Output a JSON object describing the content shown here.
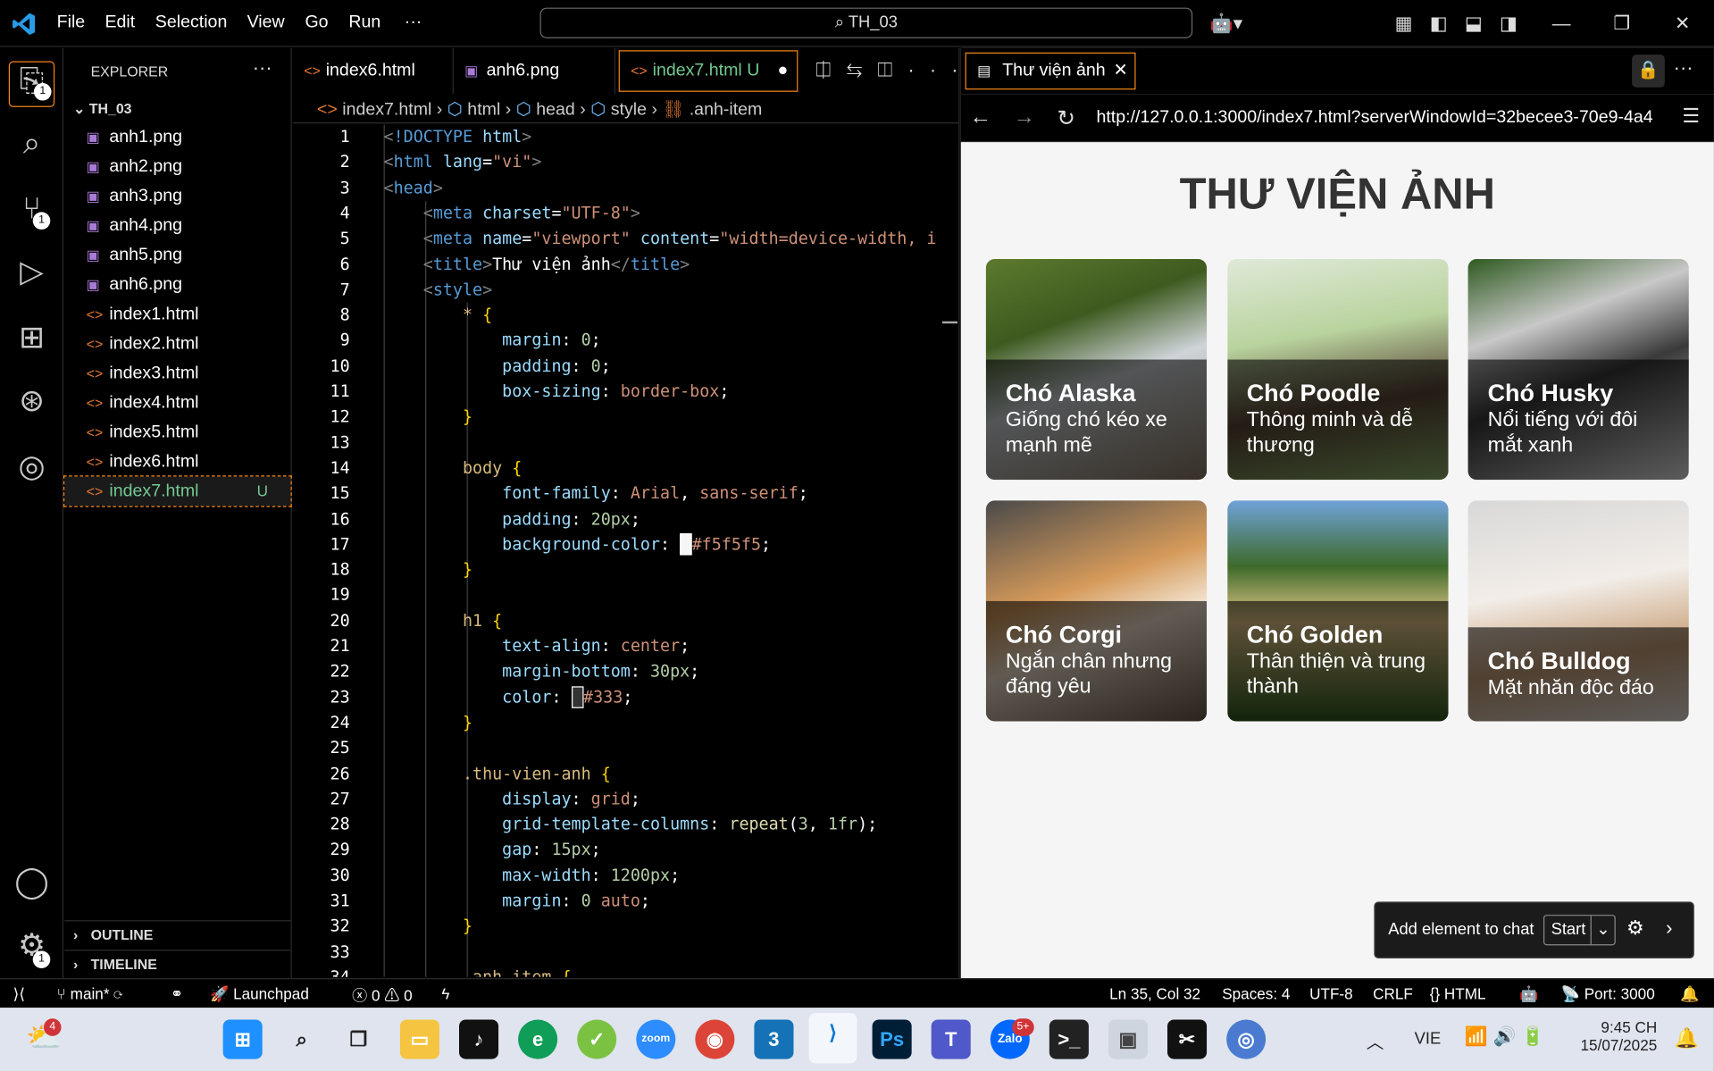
{
  "menu": [
    "File",
    "Edit",
    "Selection",
    "View",
    "Go",
    "Run",
    "···"
  ],
  "command_center": "TH_03",
  "explorer": {
    "header": "EXPLORER",
    "root": "TH_03",
    "files": [
      {
        "name": "anh1.png",
        "type": "img"
      },
      {
        "name": "anh2.png",
        "type": "img"
      },
      {
        "name": "anh3.png",
        "type": "img"
      },
      {
        "name": "anh4.png",
        "type": "img"
      },
      {
        "name": "anh5.png",
        "type": "img"
      },
      {
        "name": "anh6.png",
        "type": "img"
      },
      {
        "name": "index1.html",
        "type": "html"
      },
      {
        "name": "index2.html",
        "type": "html"
      },
      {
        "name": "index3.html",
        "type": "html"
      },
      {
        "name": "index4.html",
        "type": "html"
      },
      {
        "name": "index5.html",
        "type": "html"
      },
      {
        "name": "index6.html",
        "type": "html"
      },
      {
        "name": "index7.html",
        "type": "html",
        "status": "U"
      }
    ],
    "outline": "OUTLINE",
    "timeline": "TIMELINE"
  },
  "tabs": [
    {
      "label": "index6.html"
    },
    {
      "label": "anh6.png"
    },
    {
      "label": "index7.html",
      "status": "U"
    }
  ],
  "breadcrumb": [
    "index7.html",
    "html",
    "head",
    "style",
    ".anh-item"
  ],
  "activity_badges": {
    "explorer": "1",
    "scm": "1",
    "settings": "1"
  },
  "preview": {
    "tab": "Thư viện ảnh",
    "url": "http://127.0.0.1:3000/index7.html?serverWindowId=32becee3-70e9-4a4",
    "heading": "THƯ VIỆN ẢNH",
    "cards": [
      {
        "title": "Chó Alaska",
        "desc": "Giống chó kéo xe mạnh mẽ"
      },
      {
        "title": "Chó Poodle",
        "desc": "Thông minh và dễ thương"
      },
      {
        "title": "Chó Husky",
        "desc": "Nổi tiếng với đôi mắt xanh"
      },
      {
        "title": "Chó Corgi",
        "desc": "Ngắn chân nhưng đáng yêu"
      },
      {
        "title": "Chó Golden",
        "desc": "Thân thiện và trung thành"
      },
      {
        "title": "Chó Bulldog",
        "desc": "Mặt nhăn độc đáo"
      }
    ],
    "chat": {
      "label": "Add element to chat",
      "button": "Start"
    }
  },
  "status": {
    "branch": "main*",
    "launchpad": "Launchpad",
    "errors": "0",
    "warnings": "0",
    "position": "Ln 35, Col 32",
    "spaces": "Spaces: 4",
    "encoding": "UTF-8",
    "eol": "CRLF",
    "language": "{} HTML",
    "port": "Port: 3000"
  },
  "taskbar": {
    "lang": "VIE",
    "time": "9:45 CH",
    "date": "15/07/2025",
    "weather_badge": "4",
    "zalo_badge": "5+"
  }
}
